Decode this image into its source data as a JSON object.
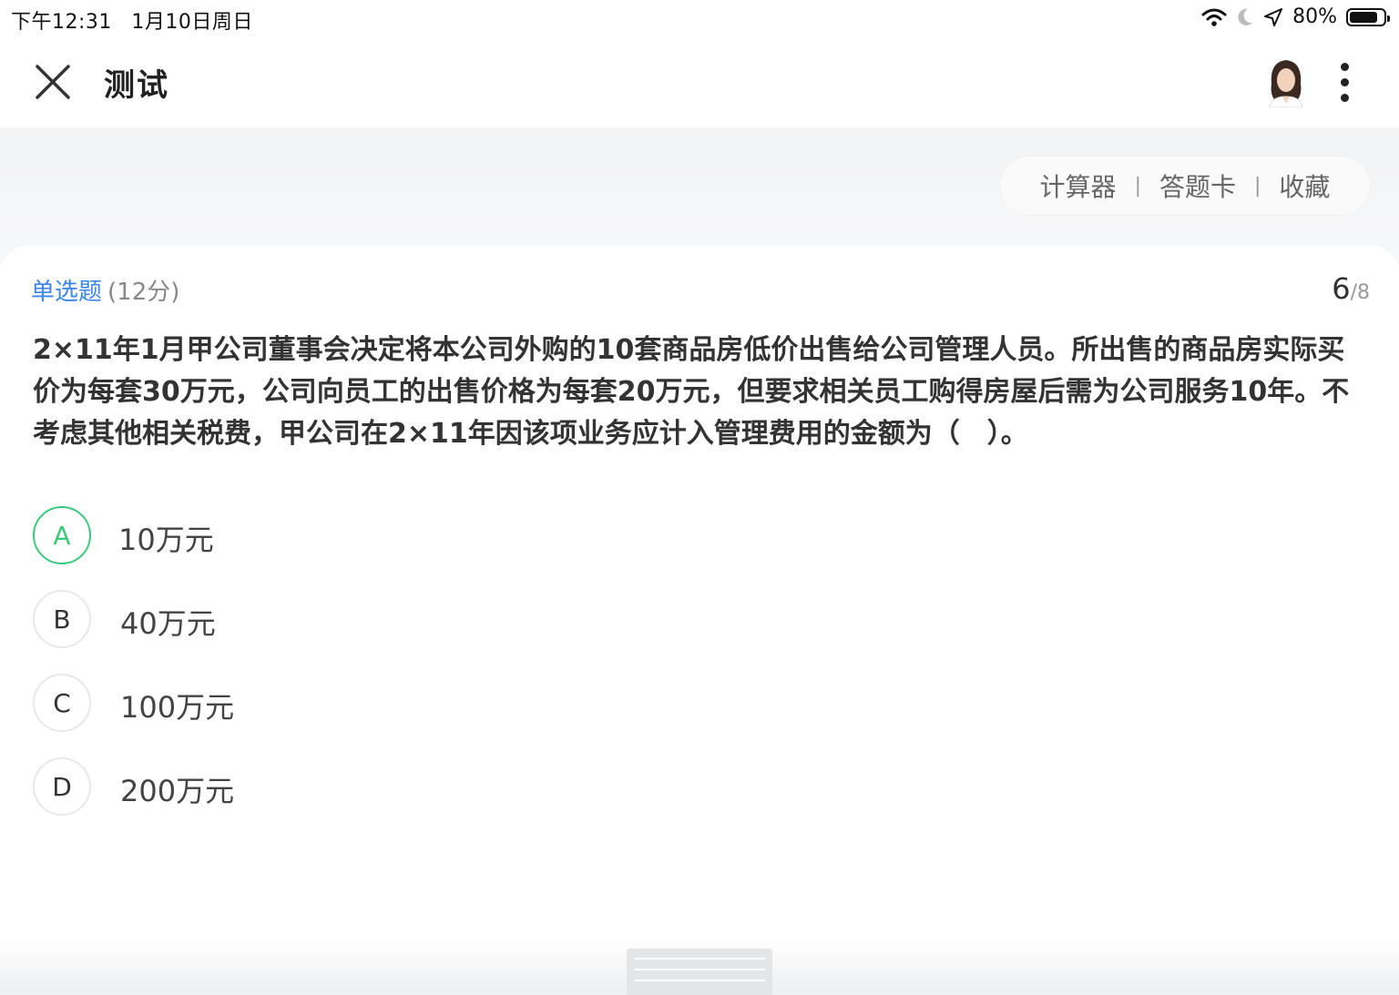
{
  "status_bar": {
    "time": "下午12:31",
    "date": "1月10日周日",
    "battery": "80%",
    "icons": [
      "wifi-icon",
      "moon-icon",
      "location-icon",
      "battery-icon"
    ]
  },
  "header": {
    "title": "测试",
    "close_icon": "close-icon",
    "more_icon": "more-vertical-icon"
  },
  "tools": {
    "calculator": "计算器",
    "separator": "|",
    "answer_card": "答题卡",
    "favorite": "收藏"
  },
  "question": {
    "type": "单选题",
    "score": "(12分)",
    "current": "6",
    "total": "/8",
    "text": "2×11年1月甲公司董事会决定将本公司外购的10套商品房低价出售给公司管理人员。所出售的商品房实际买价为每套30万元，公司向员工的出售价格为每套20万元，但要求相关员工购得房屋后需为公司服务10年。不考虑其他相关税费，甲公司在2×11年因该项业务应计入管理费用的金额为（　）。",
    "options": [
      {
        "letter": "A",
        "text": "10万元",
        "selected": true
      },
      {
        "letter": "B",
        "text": "40万元",
        "selected": false
      },
      {
        "letter": "C",
        "text": "100万元",
        "selected": false
      },
      {
        "letter": "D",
        "text": "200万元",
        "selected": false
      }
    ]
  },
  "colors": {
    "accent_blue": "#3a86ee",
    "selected_green": "#3cc87a"
  }
}
